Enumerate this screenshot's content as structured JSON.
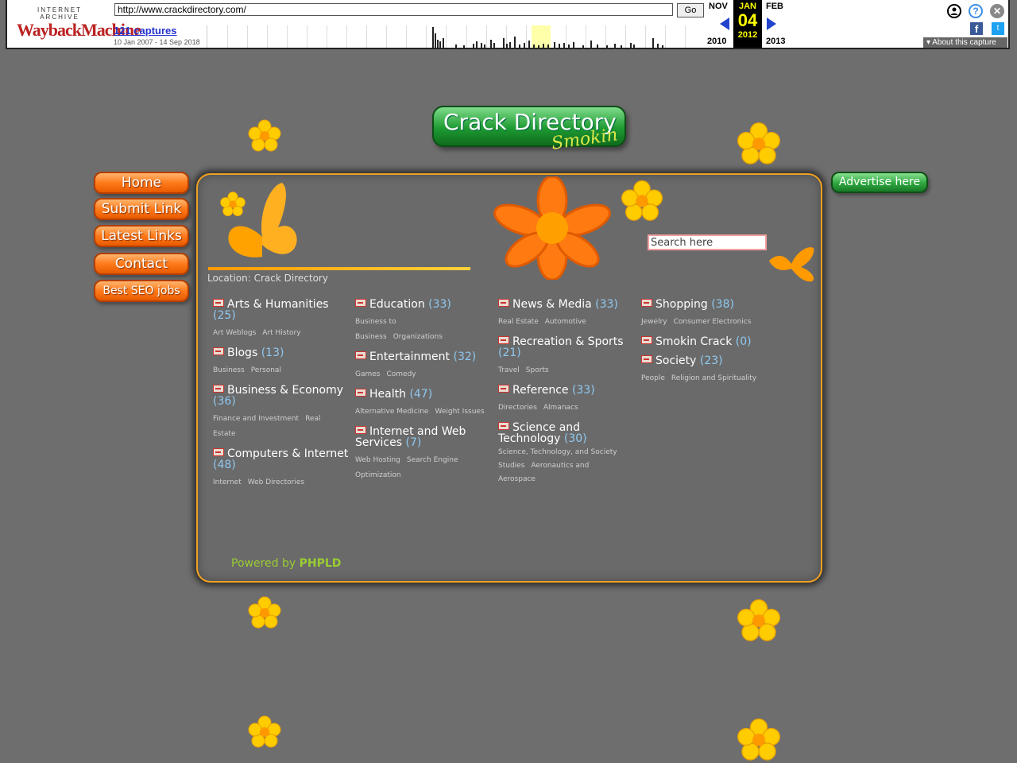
{
  "wayback": {
    "logo_top": "INTERNET ARCHIVE",
    "logo_main": "WaybackMachine",
    "url": "http://www.crackdirectory.com/",
    "go_label": "Go",
    "captures": "121 captures",
    "range": "10 Jan 2007 - 14 Sep 2018",
    "prev_month": "NOV",
    "prev_year": "2010",
    "cur_month": "JAN",
    "cur_day": "04",
    "cur_year": "2012",
    "next_month": "FEB",
    "next_year": "2013",
    "about": "About this capture",
    "help_glyph": "?",
    "close_glyph": "✕",
    "fb_glyph": "f",
    "tw_glyph": "t"
  },
  "logo": {
    "title": "Crack Directory",
    "subtitle": "Smokin"
  },
  "nav": [
    {
      "label": "Home"
    },
    {
      "label": "Submit Link"
    },
    {
      "label": "Latest Links"
    },
    {
      "label": "Contact"
    },
    {
      "label": "Best SEO jobs"
    }
  ],
  "advertise": "Advertise here",
  "search": {
    "placeholder": "Search here"
  },
  "location": "Location: Crack Directory",
  "columns": [
    [
      {
        "name": "Arts & Humanities",
        "count": "(25)",
        "subs": [
          "Art Weblogs",
          "Art History"
        ]
      },
      {
        "name": "Blogs",
        "count": "(13)",
        "subs": [
          "Business",
          "Personal"
        ]
      },
      {
        "name": "Business & Economy",
        "count": "(36)",
        "subs": [
          "Finance and Investment",
          "Real Estate"
        ]
      },
      {
        "name": "Computers & Internet",
        "count": "(48)",
        "subs": [
          "Internet",
          "Web Directories"
        ]
      }
    ],
    [
      {
        "name": "Education",
        "count": "(33)",
        "subs": [
          "Business to Business",
          "Organizations"
        ]
      },
      {
        "name": "Entertainment",
        "count": "(32)",
        "subs": [
          "Games",
          "Comedy"
        ]
      },
      {
        "name": "Health",
        "count": "(47)",
        "subs": [
          "Alternative Medicine",
          "Weight Issues"
        ]
      },
      {
        "name": "Internet and Web Services",
        "count": "(7)",
        "subs": [
          "Web Hosting",
          "Search Engine Optimization"
        ]
      }
    ],
    [
      {
        "name": "News & Media",
        "count": "(33)",
        "subs": [
          "Real Estate",
          "Automotive"
        ]
      },
      {
        "name": "Recreation & Sports",
        "count": "(21)",
        "subs": [
          "Travel",
          "Sports"
        ]
      },
      {
        "name": "Reference",
        "count": "(33)",
        "subs": [
          "Directories",
          "Almanacs"
        ]
      },
      {
        "name": "Science and Technology",
        "count": "(30)",
        "subs": [
          "Science, Technology, and Society Studies",
          "Aeronautics and Aerospace"
        ]
      }
    ],
    [
      {
        "name": "Shopping",
        "count": "(38)",
        "subs": [
          "Jewelry",
          "Consumer Electronics"
        ]
      },
      {
        "name": "Smokin Crack",
        "count": "(0)",
        "subs": []
      },
      {
        "name": "Society",
        "count": "(23)",
        "subs": [
          "People",
          "Religion and Spirituality"
        ]
      }
    ]
  ],
  "powered": {
    "prefix": "Powered by ",
    "brand": "PHPLD"
  },
  "colors": {
    "background": "#6e6e6e",
    "accent_orange": "#ff7a1a",
    "accent_green": "#2ea63e",
    "count_blue": "#8fc8f0"
  }
}
